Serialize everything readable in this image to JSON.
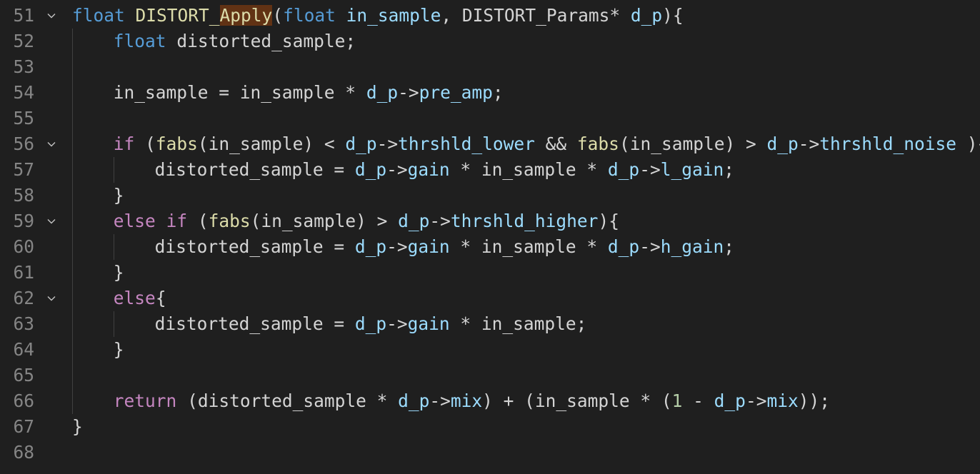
{
  "editor": {
    "lines": [
      {
        "num": "51",
        "foldable": true,
        "tokens": [
          {
            "t": "float",
            "c": "kw-type"
          },
          {
            "t": " ",
            "c": ""
          },
          {
            "t": "DISTORT_",
            "c": "fn"
          },
          {
            "t": "Apply",
            "c": "fn hl"
          },
          {
            "t": "(",
            "c": ""
          },
          {
            "t": "float",
            "c": "kw-type"
          },
          {
            "t": " ",
            "c": ""
          },
          {
            "t": "in_sample",
            "c": "var"
          },
          {
            "t": ", DISTORT_Params* ",
            "c": ""
          },
          {
            "t": "d_p",
            "c": "var"
          },
          {
            "t": "){",
            "c": ""
          }
        ]
      },
      {
        "num": "52",
        "foldable": false,
        "indent": 1,
        "tokens": [
          {
            "t": "float",
            "c": "kw-type"
          },
          {
            "t": " distorted_sample;",
            "c": ""
          }
        ]
      },
      {
        "num": "53",
        "foldable": false,
        "tokens": []
      },
      {
        "num": "54",
        "foldable": false,
        "indent": 1,
        "tokens": [
          {
            "t": "in_sample = in_sample * ",
            "c": ""
          },
          {
            "t": "d_p",
            "c": "var"
          },
          {
            "t": "->",
            "c": ""
          },
          {
            "t": "pre_amp",
            "c": "var"
          },
          {
            "t": ";",
            "c": ""
          }
        ]
      },
      {
        "num": "55",
        "foldable": false,
        "tokens": []
      },
      {
        "num": "56",
        "foldable": true,
        "indent": 1,
        "tokens": [
          {
            "t": "if",
            "c": "kw-ctrl"
          },
          {
            "t": " (",
            "c": ""
          },
          {
            "t": "fabs",
            "c": "fn"
          },
          {
            "t": "(in_sample) < ",
            "c": ""
          },
          {
            "t": "d_p",
            "c": "var"
          },
          {
            "t": "->",
            "c": ""
          },
          {
            "t": "thrshld_lower",
            "c": "var"
          },
          {
            "t": " && ",
            "c": ""
          },
          {
            "t": "fabs",
            "c": "fn"
          },
          {
            "t": "(in_sample) > ",
            "c": ""
          },
          {
            "t": "d_p",
            "c": "var"
          },
          {
            "t": "->",
            "c": ""
          },
          {
            "t": "thrshld_noise",
            "c": "var"
          },
          {
            "t": " ){",
            "c": ""
          }
        ]
      },
      {
        "num": "57",
        "foldable": false,
        "indent": 2,
        "tokens": [
          {
            "t": "distorted_sample = ",
            "c": ""
          },
          {
            "t": "d_p",
            "c": "var"
          },
          {
            "t": "->",
            "c": ""
          },
          {
            "t": "gain",
            "c": "var"
          },
          {
            "t": " * in_sample * ",
            "c": ""
          },
          {
            "t": "d_p",
            "c": "var"
          },
          {
            "t": "->",
            "c": ""
          },
          {
            "t": "l_gain",
            "c": "var"
          },
          {
            "t": ";",
            "c": ""
          }
        ]
      },
      {
        "num": "58",
        "foldable": false,
        "indent": 1,
        "tokens": [
          {
            "t": "}",
            "c": ""
          }
        ]
      },
      {
        "num": "59",
        "foldable": true,
        "indent": 1,
        "tokens": [
          {
            "t": "else",
            "c": "kw-ctrl"
          },
          {
            "t": " ",
            "c": ""
          },
          {
            "t": "if",
            "c": "kw-ctrl"
          },
          {
            "t": " (",
            "c": ""
          },
          {
            "t": "fabs",
            "c": "fn"
          },
          {
            "t": "(in_sample) > ",
            "c": ""
          },
          {
            "t": "d_p",
            "c": "var"
          },
          {
            "t": "->",
            "c": ""
          },
          {
            "t": "thrshld_higher",
            "c": "var"
          },
          {
            "t": "){",
            "c": ""
          }
        ]
      },
      {
        "num": "60",
        "foldable": false,
        "indent": 2,
        "tokens": [
          {
            "t": "distorted_sample = ",
            "c": ""
          },
          {
            "t": "d_p",
            "c": "var"
          },
          {
            "t": "->",
            "c": ""
          },
          {
            "t": "gain",
            "c": "var"
          },
          {
            "t": " * in_sample * ",
            "c": ""
          },
          {
            "t": "d_p",
            "c": "var"
          },
          {
            "t": "->",
            "c": ""
          },
          {
            "t": "h_gain",
            "c": "var"
          },
          {
            "t": ";",
            "c": ""
          }
        ]
      },
      {
        "num": "61",
        "foldable": false,
        "indent": 1,
        "tokens": [
          {
            "t": "}",
            "c": ""
          }
        ]
      },
      {
        "num": "62",
        "foldable": true,
        "indent": 1,
        "tokens": [
          {
            "t": "else",
            "c": "kw-ctrl"
          },
          {
            "t": "{",
            "c": ""
          }
        ]
      },
      {
        "num": "63",
        "foldable": false,
        "indent": 2,
        "tokens": [
          {
            "t": "distorted_sample = ",
            "c": ""
          },
          {
            "t": "d_p",
            "c": "var"
          },
          {
            "t": "->",
            "c": ""
          },
          {
            "t": "gain",
            "c": "var"
          },
          {
            "t": " * in_sample;",
            "c": ""
          }
        ]
      },
      {
        "num": "64",
        "foldable": false,
        "indent": 1,
        "tokens": [
          {
            "t": "}",
            "c": ""
          }
        ]
      },
      {
        "num": "65",
        "foldable": false,
        "tokens": []
      },
      {
        "num": "66",
        "foldable": false,
        "indent": 1,
        "tokens": [
          {
            "t": "return",
            "c": "kw-ctrl"
          },
          {
            "t": " (distorted_sample * ",
            "c": ""
          },
          {
            "t": "d_p",
            "c": "var"
          },
          {
            "t": "->",
            "c": ""
          },
          {
            "t": "mix",
            "c": "var"
          },
          {
            "t": ") + (in_sample * (",
            "c": ""
          },
          {
            "t": "1",
            "c": "num"
          },
          {
            "t": " - ",
            "c": ""
          },
          {
            "t": "d_p",
            "c": "var"
          },
          {
            "t": "->",
            "c": ""
          },
          {
            "t": "mix",
            "c": "var"
          },
          {
            "t": "));",
            "c": ""
          }
        ]
      },
      {
        "num": "67",
        "foldable": false,
        "indent": 0,
        "tokens": [
          {
            "t": "}",
            "c": ""
          }
        ]
      },
      {
        "num": "68",
        "foldable": false,
        "tokens": []
      }
    ]
  },
  "colors": {
    "background": "#1f1f1f",
    "line_number": "#858585",
    "keyword_type": "#569cd6",
    "keyword_control": "#c586c0",
    "function": "#dcdcaa",
    "variable": "#9cdcfe",
    "number": "#b5cea8",
    "default_text": "#d4d4d4",
    "find_highlight": "#613214"
  },
  "icons": {
    "fold": "chevron-down-icon"
  }
}
